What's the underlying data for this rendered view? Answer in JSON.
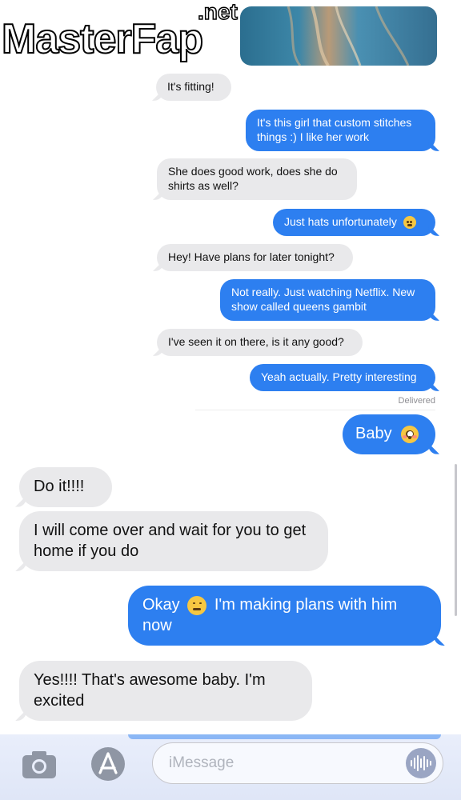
{
  "watermark": {
    "brand": "MasterFap",
    "suffix": ".net"
  },
  "messages": [
    {
      "id": "m1",
      "direction": "in",
      "text": "It's fitting!"
    },
    {
      "id": "m2",
      "direction": "out",
      "text": "It's this girl that custom stitches things :) I like her work"
    },
    {
      "id": "m3",
      "direction": "in",
      "text": "She does good work, does she do shirts as well?"
    },
    {
      "id": "m4",
      "direction": "out",
      "text": "Just hats unfortunately",
      "emoji": "weary-face-emoji"
    },
    {
      "id": "m5",
      "direction": "in",
      "text": "Hey! Have plans for later tonight?"
    },
    {
      "id": "m6",
      "direction": "out",
      "text": "Not really. Just watching Netflix. New show called queens gambit"
    },
    {
      "id": "m7",
      "direction": "in",
      "text": "I've seen it on there, is it any good?"
    },
    {
      "id": "m8",
      "direction": "out",
      "text": "Yeah actually. Pretty interesting"
    },
    {
      "id": "m9",
      "direction": "out",
      "text": "Baby",
      "emoji": "flushed-face-emoji"
    },
    {
      "id": "m10",
      "direction": "in",
      "text": "Do it!!!!"
    },
    {
      "id": "m11",
      "direction": "in",
      "text": "I will come over and wait for you to get home if you do"
    },
    {
      "id": "m12",
      "direction": "out",
      "text_before": "Okay",
      "text_after": "I'm making plans with him now",
      "emoji": "relieved-face-emoji"
    },
    {
      "id": "m13",
      "direction": "in",
      "text": "Yes!!!! That's awesome baby. I'm excited"
    }
  ],
  "status": {
    "delivered": "Delivered"
  },
  "compose": {
    "placeholder": "iMessage",
    "camera_icon": "camera-icon",
    "apps_icon": "app-store-icon",
    "audio_icon": "audio-waveform-icon"
  },
  "colors": {
    "incoming": "#e9e9eb",
    "outgoing": "#2d7ff0"
  }
}
